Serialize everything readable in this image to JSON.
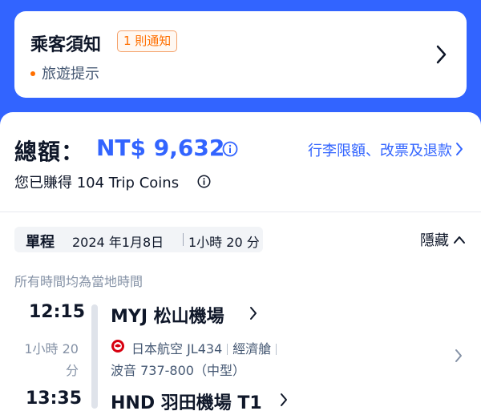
{
  "notice": {
    "title": "乘客須知",
    "badge": "1 則通知",
    "subtitle": "旅遊提示"
  },
  "summary": {
    "total_label": "總額：",
    "total_value": "NT$ 9,632",
    "fee_link": "行李限額、改票及退款",
    "coins_text": "您已賺得 104 Trip Coins"
  },
  "trip": {
    "type": "單程",
    "date": "2024 年1月8日",
    "duration": "1小時 20 分",
    "hide_label": "隱藏",
    "local_note": "所有時間均為當地時間"
  },
  "segment": {
    "dep_time": "12:15",
    "dep_airport": "MYJ  松山機場",
    "duration_line1": "1小時 20",
    "duration_line2": "分",
    "airline": "日本航空 JL434",
    "cabin": "經濟艙",
    "aircraft": "波音 737-800（中型）",
    "arr_time": "13:35",
    "arr_airport": "HND  羽田機場 T1"
  },
  "colors": {
    "brand_blue": "#3264ff",
    "badge_orange": "#ff6f00",
    "airline_red": "#d7000f"
  },
  "icons": [
    "chevron-right-icon",
    "info-icon",
    "chevron-up-icon",
    "airline-logo-icon"
  ]
}
